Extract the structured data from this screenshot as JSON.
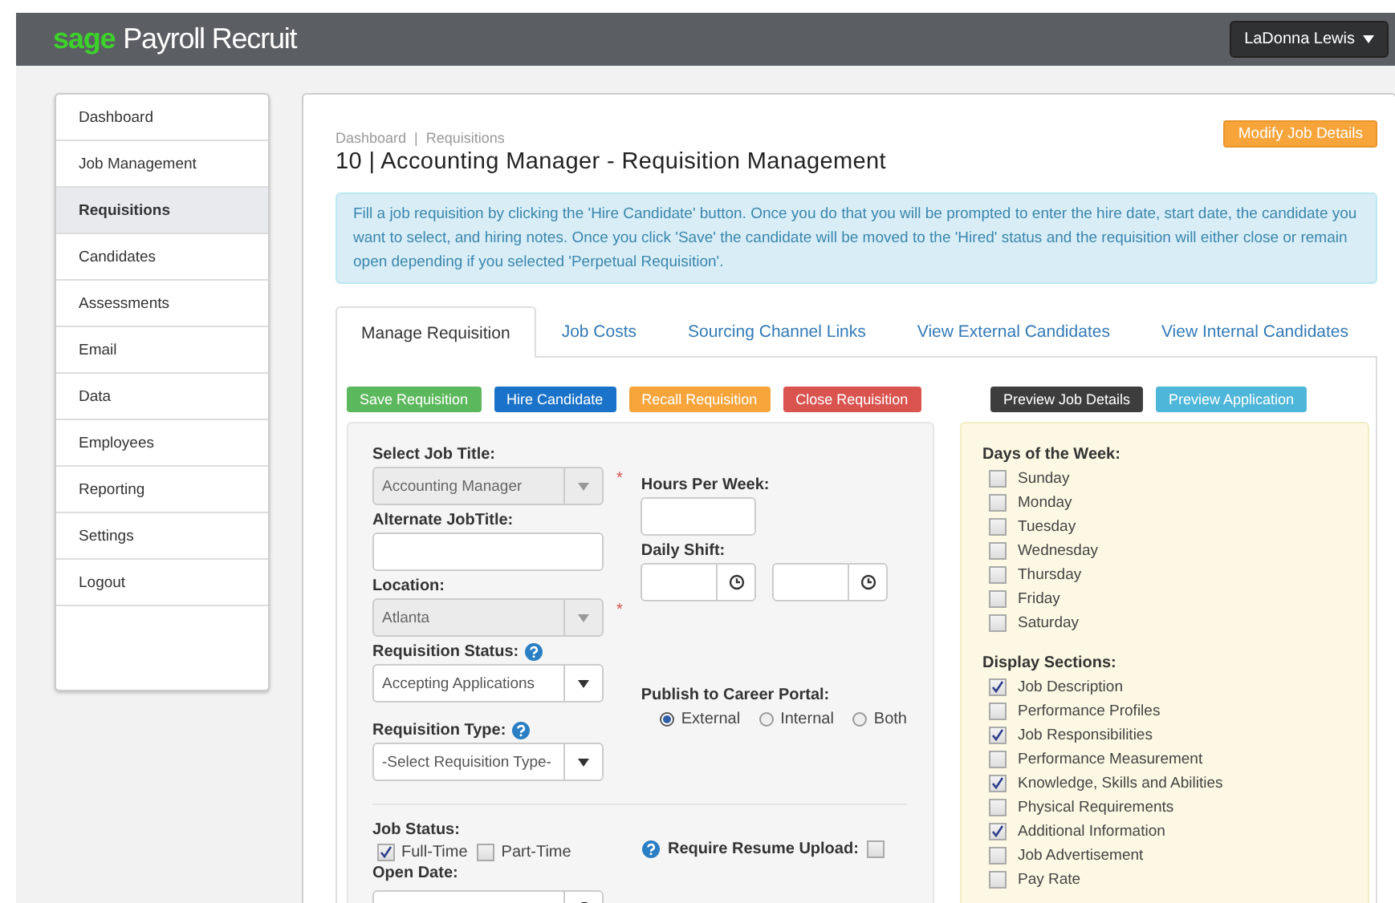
{
  "header": {
    "brand_mark": "sage",
    "brand_name": "Payroll Recruit",
    "user_menu": "LaDonna Lewis"
  },
  "sidebar": {
    "items": [
      {
        "label": "Dashboard",
        "selected": false
      },
      {
        "label": "Job Management",
        "selected": false
      },
      {
        "label": "Requisitions",
        "selected": true
      },
      {
        "label": "Candidates",
        "selected": false
      },
      {
        "label": "Assessments",
        "selected": false
      },
      {
        "label": "Email",
        "selected": false
      },
      {
        "label": "Data",
        "selected": false
      },
      {
        "label": "Employees",
        "selected": false
      },
      {
        "label": "Reporting",
        "selected": false
      },
      {
        "label": "Settings",
        "selected": false
      },
      {
        "label": "Logout",
        "selected": false
      }
    ]
  },
  "breadcrumb": {
    "items": [
      "Dashboard",
      "Requisitions"
    ],
    "separator": "|"
  },
  "title": "10 | Accounting Manager - Requisition Management",
  "modify_button": "Modify Job Details",
  "info_text": "Fill a job requisition by clicking the 'Hire Candidate' button. Once you do that you will be prompted to enter the hire date, start date, the candidate you want to select, and hiring notes. Once you click 'Save' the candidate will be moved to the 'Hired' status and the requisition will either close or remain open depending if you selected 'Perpetual Requisition'.",
  "tabs": [
    {
      "label": "Manage Requisition",
      "selected": true
    },
    {
      "label": "Job Costs",
      "selected": false
    },
    {
      "label": "Sourcing Channel Links",
      "selected": false
    },
    {
      "label": "View External Candidates",
      "selected": false
    },
    {
      "label": "View Internal Candidates",
      "selected": false
    }
  ],
  "action_buttons": [
    {
      "label": "Save Requisition",
      "color": "#5cb85c"
    },
    {
      "label": "Hire Candidate",
      "color": "#1a73c9"
    },
    {
      "label": "Recall Requisition",
      "color": "#f7a53b"
    },
    {
      "label": "Close Requisition",
      "color": "#d9534f"
    }
  ],
  "preview_buttons": [
    {
      "label": "Preview Job Details",
      "color": "#3d3d3d"
    },
    {
      "label": "Preview Application",
      "color": "#4db6d9"
    }
  ],
  "form": {
    "required_mark": "*",
    "fields": [
      {
        "kind": "select",
        "label": "Select Job Title:",
        "value": "Accounting Manager",
        "disabled": true,
        "required": true,
        "help": false
      },
      {
        "kind": "input",
        "label": "Alternate JobTitle:",
        "required": false,
        "help": false
      },
      {
        "kind": "select",
        "label": "Location:",
        "value": "Atlanta",
        "disabled": true,
        "required": true,
        "help": false
      },
      {
        "kind": "select",
        "label": "Requisition Status:",
        "value": "Accepting Applications",
        "disabled": false,
        "required": false,
        "help": true
      },
      {
        "kind": "select",
        "label": "Requisition Type:",
        "value": "-Select Requisition Type-",
        "disabled": false,
        "required": false,
        "help": true
      }
    ],
    "hours_label": "Hours Per Week:",
    "shift_label": "Daily Shift:",
    "publish": {
      "label": "Publish to Career Portal:",
      "options": [
        {
          "label": "External",
          "selected": true
        },
        {
          "label": "Internal",
          "selected": false
        },
        {
          "label": "Both",
          "selected": false
        }
      ]
    },
    "job_status": {
      "label": "Job Status:",
      "options": [
        {
          "label": "Full-Time",
          "checked": true
        },
        {
          "label": "Part-Time",
          "checked": false
        }
      ]
    },
    "open_date": {
      "label": "Open Date:"
    },
    "resume_upload": {
      "label": "Require Resume Upload:",
      "checked": false
    }
  },
  "days": {
    "label": "Days of the Week:",
    "items": [
      {
        "label": "Sunday",
        "checked": false
      },
      {
        "label": "Monday",
        "checked": false
      },
      {
        "label": "Tuesday",
        "checked": false
      },
      {
        "label": "Wednesday",
        "checked": false
      },
      {
        "label": "Thursday",
        "checked": false
      },
      {
        "label": "Friday",
        "checked": false
      },
      {
        "label": "Saturday",
        "checked": false
      }
    ]
  },
  "sections": {
    "label": "Display Sections:",
    "items": [
      {
        "label": "Job Description",
        "checked": true
      },
      {
        "label": "Performance Profiles",
        "checked": false
      },
      {
        "label": "Job Responsibilities",
        "checked": true
      },
      {
        "label": "Performance Measurement",
        "checked": false
      },
      {
        "label": "Knowledge, Skills and Abilities",
        "checked": true
      },
      {
        "label": "Physical Requirements",
        "checked": false
      },
      {
        "label": "Additional Information",
        "checked": true
      },
      {
        "label": "Job Advertisement",
        "checked": false
      },
      {
        "label": "Pay Rate",
        "checked": false
      }
    ]
  }
}
